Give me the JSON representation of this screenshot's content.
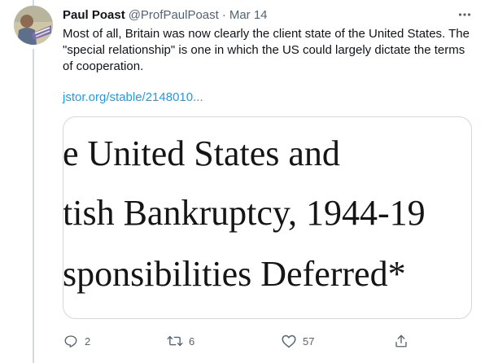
{
  "tweet": {
    "display_name": "Paul Poast",
    "handle": "@ProfPaulPoast",
    "separator": "·",
    "date": "Mar 14",
    "text": "Most of all, Britain was now clearly the client state of the United States. The \"special relationship\" is one in which the US could largely dictate the terms of cooperation.",
    "link_text": "jstor.org/stable/2148010..."
  },
  "media": {
    "lines": [
      "e United States and",
      "tish Bankruptcy, 1944-19",
      "sponsibilities Deferred*"
    ]
  },
  "actions": {
    "reply_count": "2",
    "retweet_count": "6",
    "like_count": "57"
  },
  "icons": {
    "reply": "reply-icon",
    "retweet": "retweet-icon",
    "like": "heart-icon",
    "share": "share-icon",
    "more": "more-icon"
  },
  "colors": {
    "link": "#1d9bf0",
    "secondary_text": "#536471",
    "primary_text": "#0f1419",
    "border": "#cfd9de"
  }
}
